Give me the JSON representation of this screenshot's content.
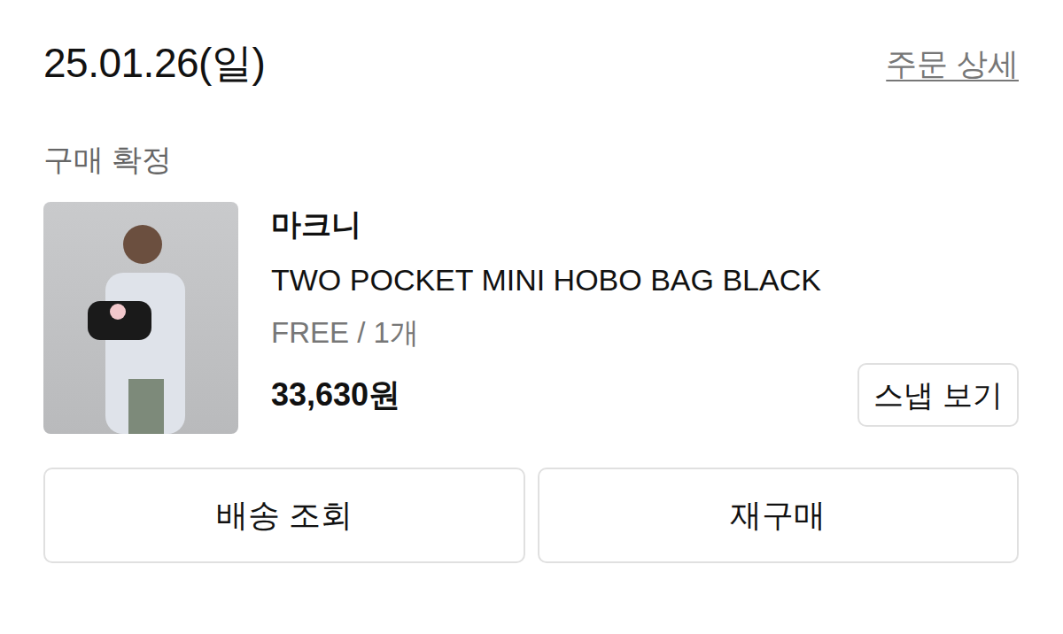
{
  "order": {
    "date": "25.01.26(일)",
    "detail_link": "주문 상세",
    "status": "구매 확정",
    "item": {
      "brand": "마크니",
      "name": "TWO POCKET MINI HOBO BAG BLACK",
      "option": "FREE / 1개",
      "price": "33,630원",
      "snap_button": "스냅 보기"
    }
  },
  "buttons": [
    {
      "label": "배송 조회"
    },
    {
      "label": "재구매"
    }
  ]
}
